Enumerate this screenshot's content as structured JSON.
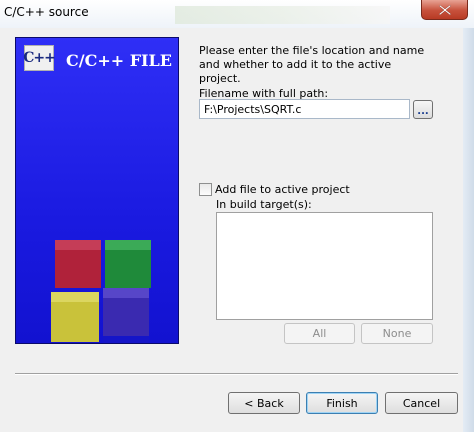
{
  "window": {
    "title": "C/C++ source",
    "close_icon": "close-icon"
  },
  "banner": {
    "logo_text": "C++",
    "caption": "C/C++ FILE",
    "cube_colors": [
      "#b0223a",
      "#1f8a3a",
      "#c9c23a",
      "#3a2ab0"
    ]
  },
  "form": {
    "prompt": "Please enter the file's location and name and whether to add it to the active project.",
    "filename_label": "Filename with full path:",
    "filename_value": "F:\\Projects\\SQRT.c",
    "browse_label": "...",
    "add_to_project_label": "Add file to active project",
    "add_to_project_checked": false,
    "build_targets_label": "In build target(s):",
    "build_targets": [],
    "all_label": "All",
    "none_label": "None"
  },
  "buttons": {
    "back": "< Back",
    "finish": "Finish",
    "cancel": "Cancel"
  },
  "colors": {
    "banner_blue": "#1a1ae0",
    "close_red": "#c7513c",
    "dialog_bg": "#f0f0f0"
  }
}
